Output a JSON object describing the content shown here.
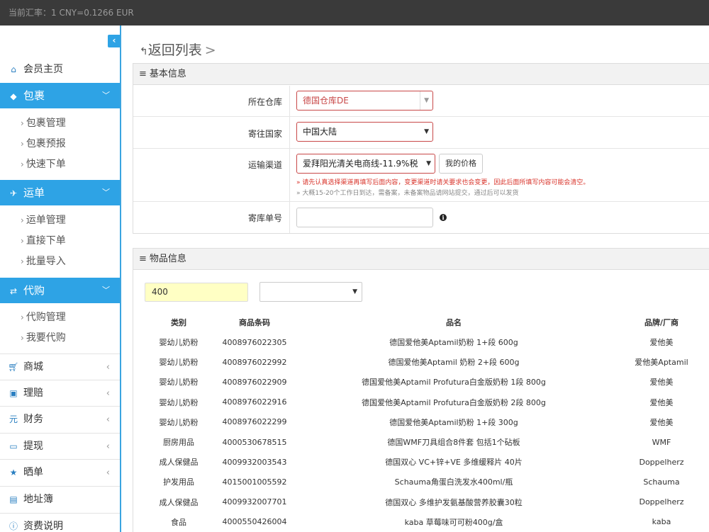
{
  "topbar": {
    "rate_text": "当前汇率：1 CNY=0.1266 EUR"
  },
  "sidebar": {
    "collapse_glyph": "‹",
    "home": "会员主页",
    "sections": [
      {
        "label": "包裹",
        "items": [
          "包裹管理",
          "包裹预报",
          "快速下单"
        ]
      },
      {
        "label": "运单",
        "items": [
          "运单管理",
          "直接下单",
          "批量导入"
        ]
      },
      {
        "label": "代购",
        "items": [
          "代购管理",
          "我要代购"
        ]
      }
    ],
    "plain": [
      "商城",
      "理赔",
      "财务",
      "提现",
      "晒单",
      "地址簿",
      "资费说明"
    ]
  },
  "main": {
    "back_label": "返回列表",
    "back_sep": ">",
    "basic": {
      "title": "基本信息",
      "warehouse_label": "所在仓库",
      "warehouse_value": "德国仓库DE",
      "country_label": "寄往国家",
      "country_value": "中国大陆",
      "channel_label": "运输渠道",
      "channel_value": "爱拜阳光清关电商线-11.9%税",
      "price_button": "我的价格",
      "note_red": "» 请先认真选择渠道再填写后面内容，变更渠道时请关要求也会变更，因此后面所填写内容可能会清空。",
      "note_grey": "» 大概15-20个工作日到达，需备案，未备案物品请网站提交，通过后可以发货",
      "tracking_label": "寄库单号",
      "tracking_value": ""
    },
    "goods": {
      "title": "物品信息",
      "search_value": "400",
      "category_value": "",
      "headers": [
        "类别",
        "商品条码",
        "品名",
        "品牌/厂商"
      ],
      "rows": [
        [
          "婴幼儿奶粉",
          "4008976022305",
          "德国爱他美Aptamil奶粉 1+段 600g",
          "爱他美"
        ],
        [
          "婴幼儿奶粉",
          "4008976022992",
          "德国爱他美Aptamil 奶粉 2+段 600g",
          "爱他美Aptamil"
        ],
        [
          "婴幼儿奶粉",
          "4008976022909",
          "德国爱他美Aptamil Profutura白金版奶粉 1段 800g",
          "爱他美"
        ],
        [
          "婴幼儿奶粉",
          "4008976022916",
          "德国爱他美Aptamil Profutura白金版奶粉 2段 800g",
          "爱他美"
        ],
        [
          "婴幼儿奶粉",
          "4008976022299",
          "德国爱他美Aptamil奶粉 1+段 300g",
          "爱他美"
        ],
        [
          "厨房用品",
          "4000530678515",
          "德国WMF刀具组合8件套 包括1个砧板",
          "WMF"
        ],
        [
          "成人保健品",
          "4009932003543",
          "德国双心 VC+锌+VE 多维缓释片 40片",
          "Doppelherz"
        ],
        [
          "护发用品",
          "4015001005592",
          "Schauma角蛋白洗发水400ml/瓶",
          "Schauma"
        ],
        [
          "成人保健品",
          "4009932007701",
          "德国双心 多维护发氨基酸营养胶囊30粒",
          "Doppelherz"
        ],
        [
          "食品",
          "4000550426004",
          "kaba 草莓味可可粉400g/盒",
          "kaba"
        ]
      ]
    }
  }
}
